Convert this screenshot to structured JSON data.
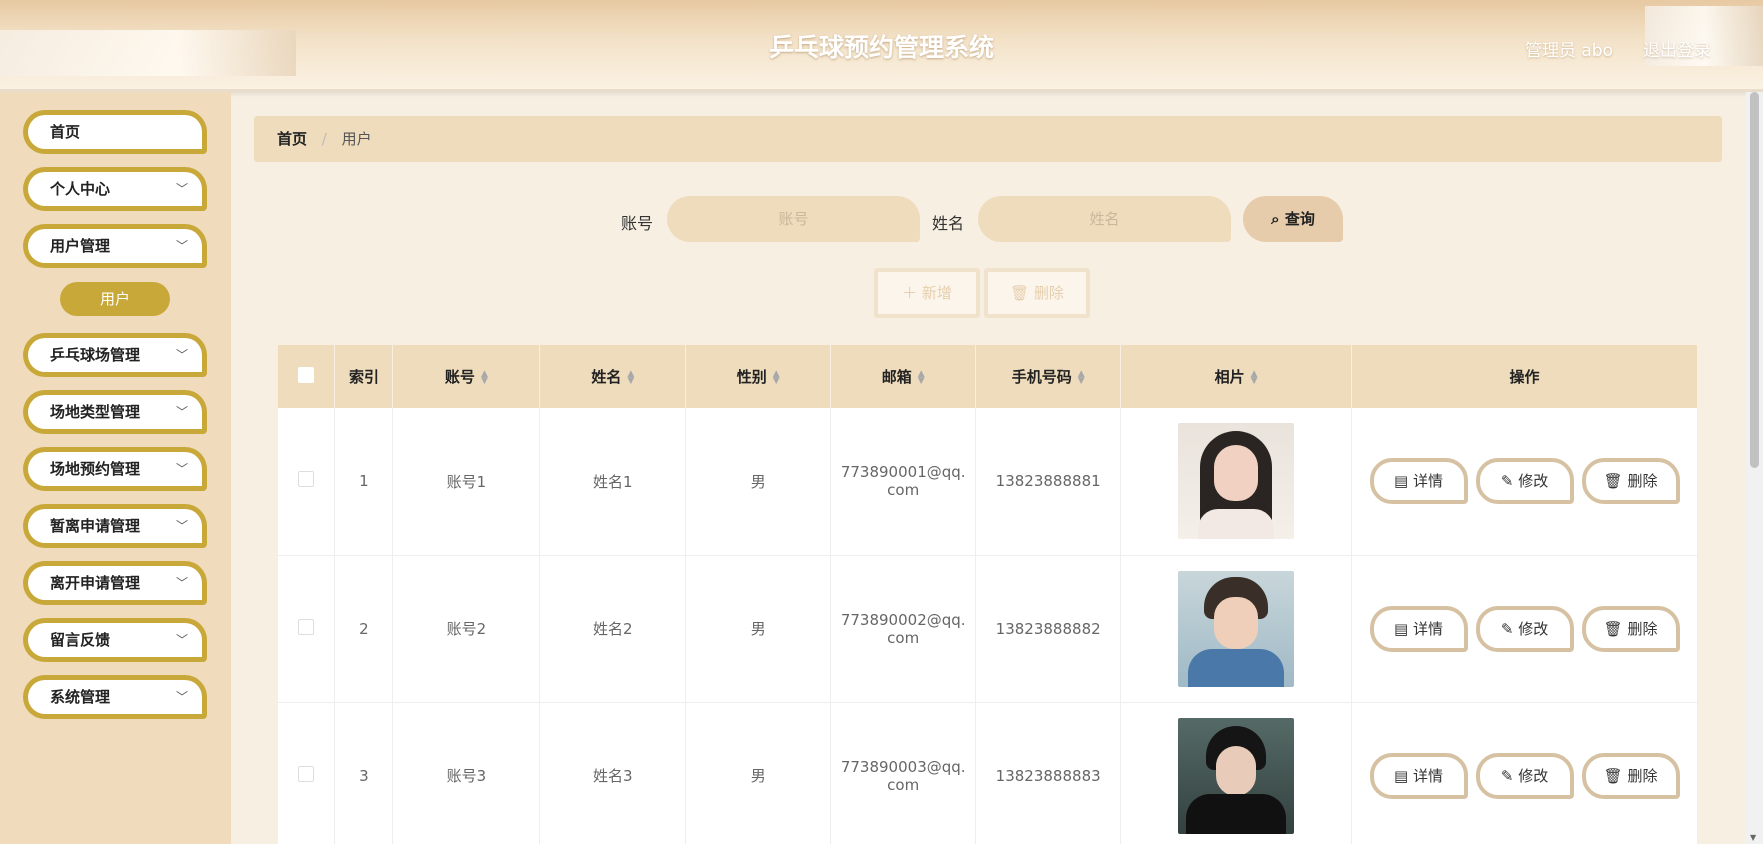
{
  "header": {
    "title": "乒乓球预约管理系统",
    "user": "管理员 abo",
    "logout": "退出登录"
  },
  "sidebar": {
    "items": [
      {
        "label": "首页",
        "has_arrow": false
      },
      {
        "label": "个人中心",
        "has_arrow": true
      },
      {
        "label": "用户管理",
        "has_arrow": true
      },
      {
        "label": "乒乓球场管理",
        "has_arrow": true
      },
      {
        "label": "场地类型管理",
        "has_arrow": true
      },
      {
        "label": "场地预约管理",
        "has_arrow": true
      },
      {
        "label": "暂离申请管理",
        "has_arrow": true
      },
      {
        "label": "离开申请管理",
        "has_arrow": true
      },
      {
        "label": "留言反馈",
        "has_arrow": true
      },
      {
        "label": "系统管理",
        "has_arrow": true
      }
    ],
    "active_sub": "用户"
  },
  "breadcrumb": {
    "home": "首页",
    "separator": "/",
    "current": "用户"
  },
  "search": {
    "account_label": "账号",
    "account_placeholder": "账号",
    "name_label": "姓名",
    "name_placeholder": "姓名",
    "query_button": "查询"
  },
  "actions": {
    "add": "新增",
    "delete": "删除"
  },
  "table": {
    "headers": {
      "index": "索引",
      "account": "账号",
      "name": "姓名",
      "gender": "性别",
      "email": "邮箱",
      "phone": "手机号码",
      "photo": "相片",
      "operation": "操作"
    },
    "rows": [
      {
        "index": "1",
        "account": "账号1",
        "name": "姓名1",
        "gender": "男",
        "email_1": "773890001@qq.",
        "email_2": "com",
        "phone": "13823888881"
      },
      {
        "index": "2",
        "account": "账号2",
        "name": "姓名2",
        "gender": "男",
        "email_1": "773890002@qq.",
        "email_2": "com",
        "phone": "13823888882"
      },
      {
        "index": "3",
        "account": "账号3",
        "name": "姓名3",
        "gender": "男",
        "email_1": "773890003@qq.",
        "email_2": "com",
        "phone": "13823888883"
      }
    ],
    "row_buttons": {
      "detail": "详情",
      "edit": "修改",
      "delete": "删除"
    }
  },
  "colors": {
    "accent": "#c9a83a",
    "panel": "#efdcbd",
    "sidebar": "#f0dcbc"
  }
}
